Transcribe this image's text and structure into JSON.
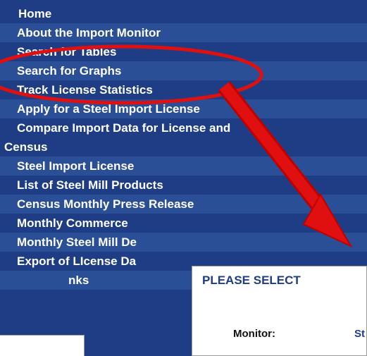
{
  "nav": {
    "items": [
      {
        "label": "Home"
      },
      {
        "label": "About the Import Monitor"
      },
      {
        "label": "Search for Tables"
      },
      {
        "label": "Search for Graphs"
      },
      {
        "label": "Track License Statistics"
      },
      {
        "label": "Apply for a Steel Import License"
      },
      {
        "label": "Compare Import Data for License and"
      },
      {
        "label": "Census"
      },
      {
        "label": "Steel Import License"
      },
      {
        "label": "List of Steel Mill Products"
      },
      {
        "label": "Census Monthly Press Release"
      },
      {
        "label": "Monthly Commerce"
      },
      {
        "label": "Monthly Steel Mill De"
      },
      {
        "label": "Export of LIcense Da"
      },
      {
        "label": "nks"
      }
    ]
  },
  "popup": {
    "title": "PLEASE SELECT",
    "monitor_label": "Monitor:",
    "monitor_value": "St"
  },
  "colors": {
    "nav_bg": "#1f3d84",
    "nav_alt": "#2a4f96",
    "annotation_red": "#e01010"
  }
}
